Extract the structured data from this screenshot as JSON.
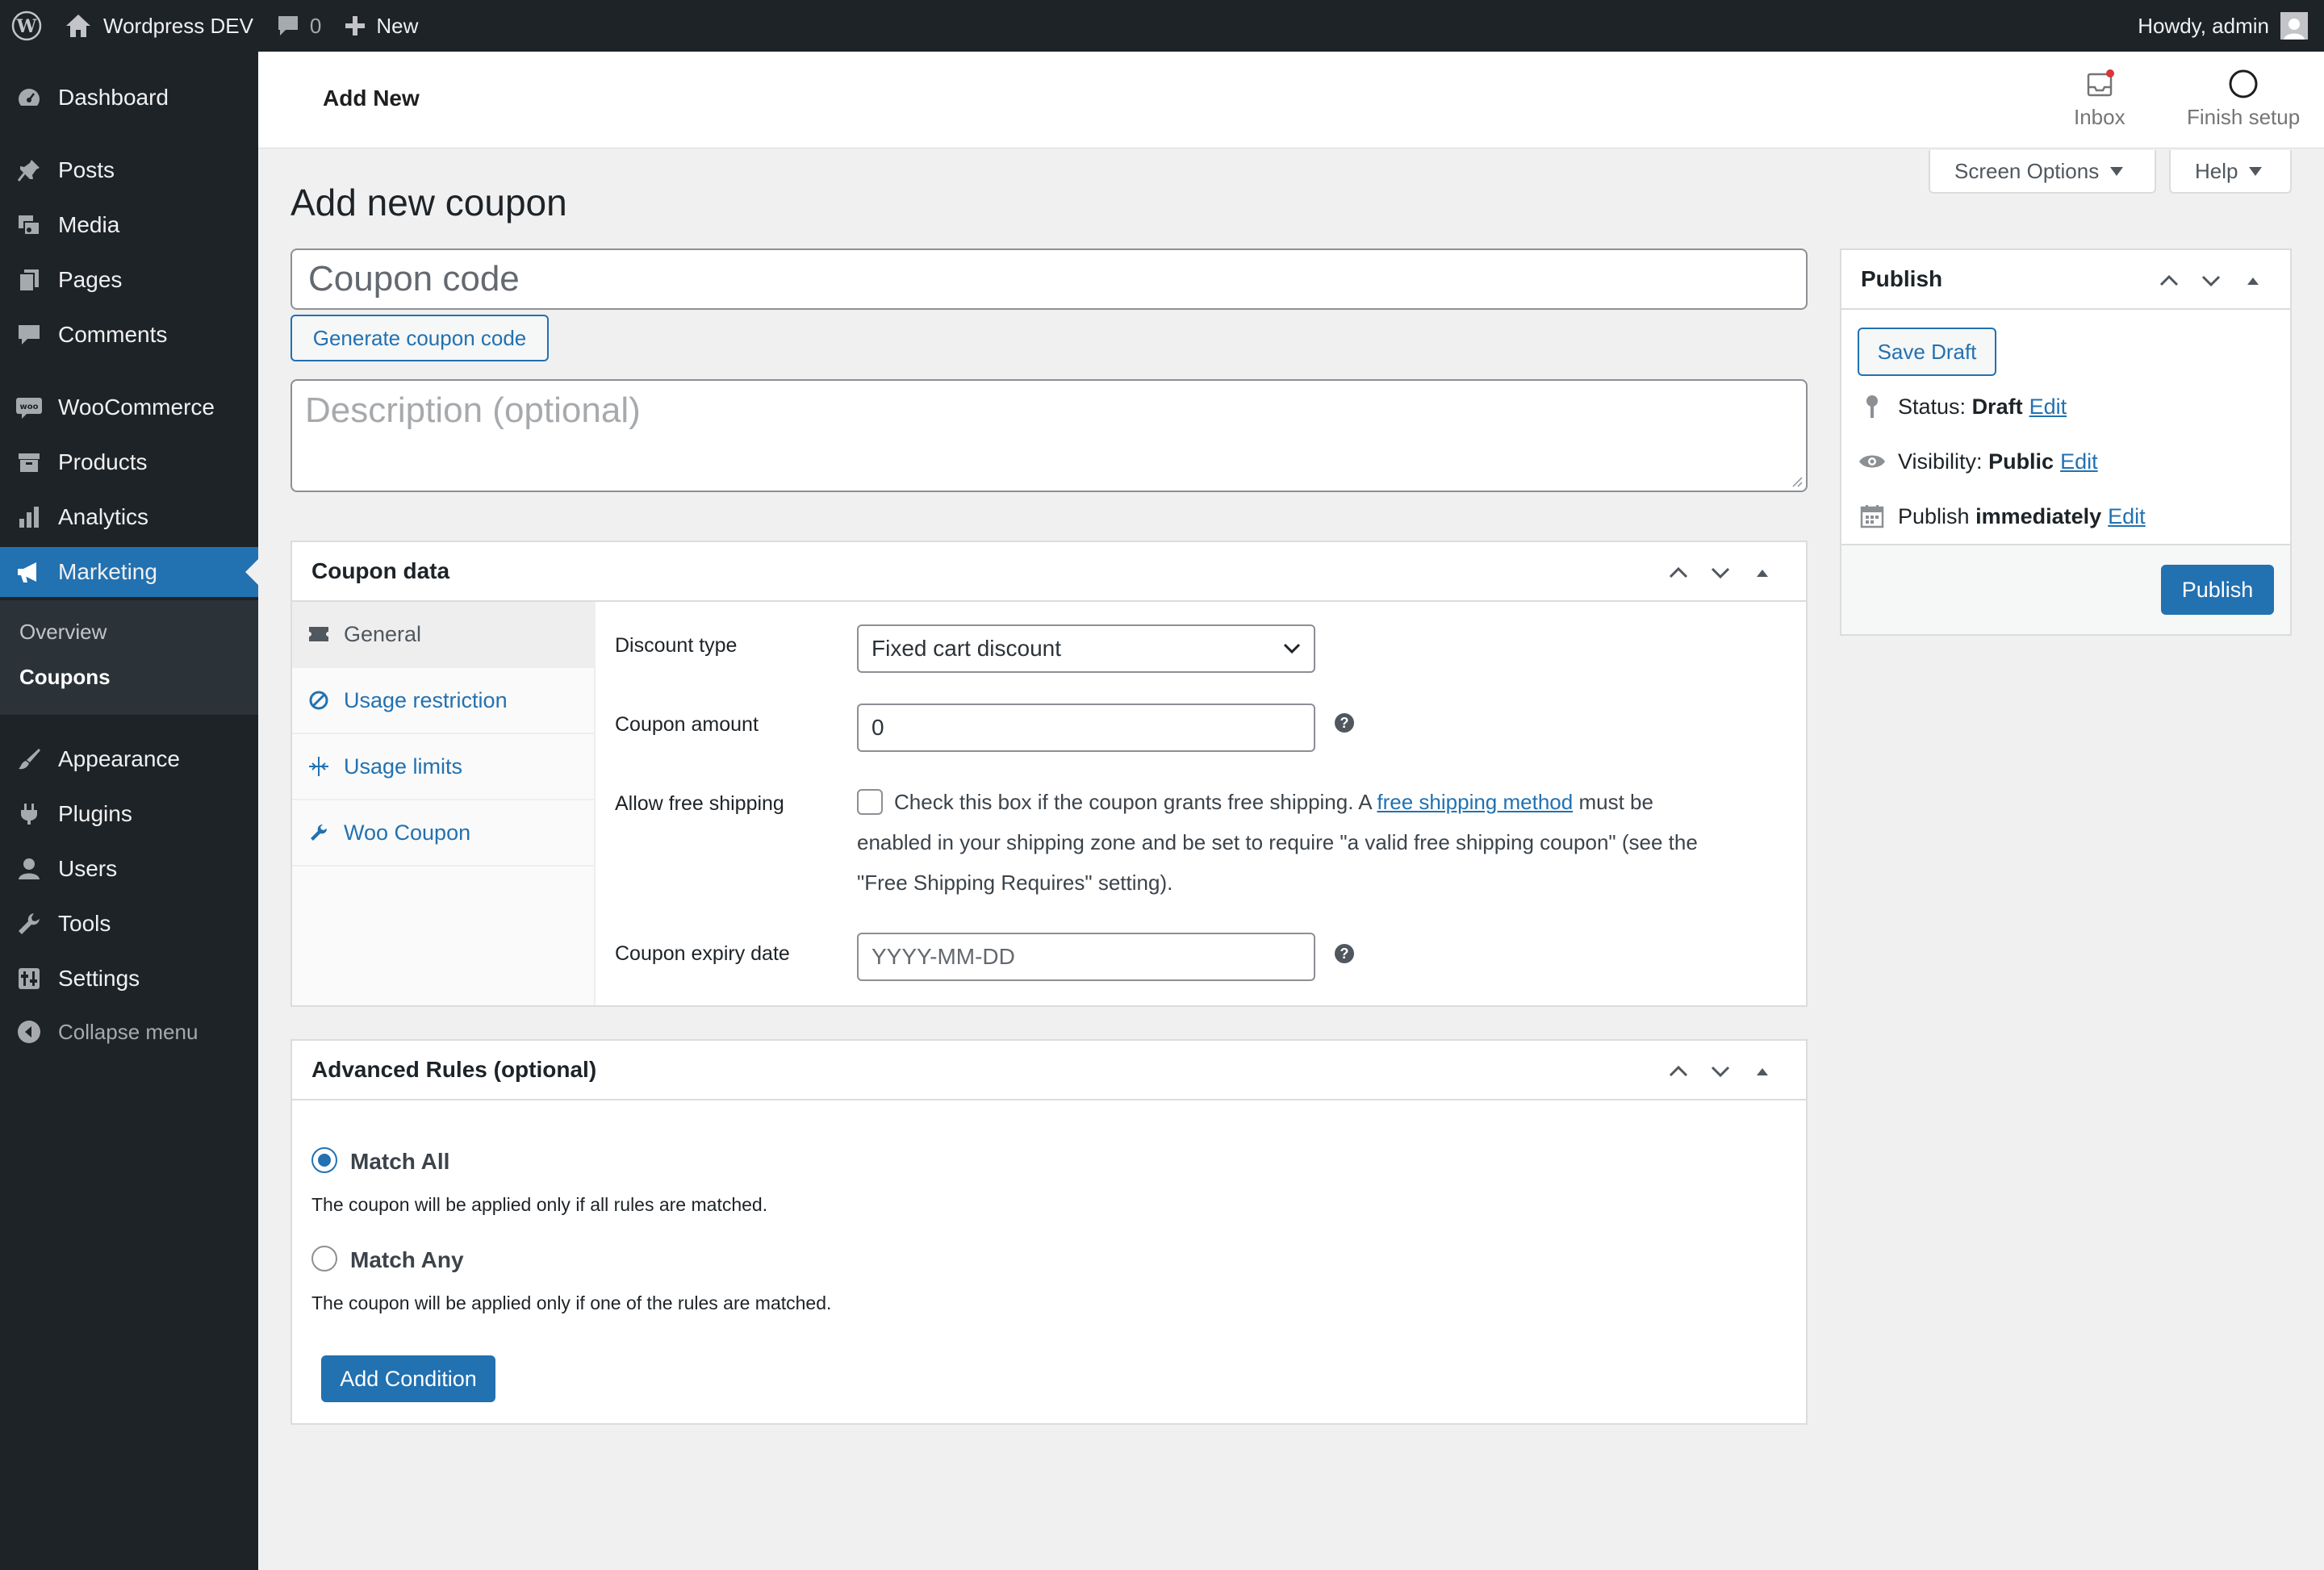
{
  "adminbar": {
    "site_name": "Wordpress DEV",
    "comments_count": "0",
    "new_label": "New",
    "howdy": "Howdy, admin"
  },
  "sidebar": {
    "items": [
      {
        "label": "Dashboard",
        "icon": "dashboard-icon"
      },
      {
        "label": "Posts",
        "icon": "pin-icon"
      },
      {
        "label": "Media",
        "icon": "media-icon"
      },
      {
        "label": "Pages",
        "icon": "pages-icon"
      },
      {
        "label": "Comments",
        "icon": "comment-icon"
      },
      {
        "label": "WooCommerce",
        "icon": "woo-icon"
      },
      {
        "label": "Products",
        "icon": "archive-icon"
      },
      {
        "label": "Analytics",
        "icon": "bar-chart-icon"
      },
      {
        "label": "Marketing",
        "icon": "megaphone-icon"
      },
      {
        "label": "Appearance",
        "icon": "brush-icon"
      },
      {
        "label": "Plugins",
        "icon": "plugin-icon"
      },
      {
        "label": "Users",
        "icon": "user-icon"
      },
      {
        "label": "Tools",
        "icon": "wrench-icon"
      },
      {
        "label": "Settings",
        "icon": "settings-icon"
      },
      {
        "label": "Collapse menu",
        "icon": "collapse-icon"
      }
    ],
    "submenu": [
      "Overview",
      "Coupons"
    ]
  },
  "header": {
    "title": "Add New",
    "inbox": "Inbox",
    "finish_setup": "Finish setup"
  },
  "tabs": {
    "screen_options": "Screen Options",
    "help": "Help"
  },
  "page": {
    "title": "Add new coupon",
    "coupon_code_placeholder": "Coupon code",
    "generate_button": "Generate coupon code",
    "description_placeholder": "Description (optional)"
  },
  "coupon_data": {
    "title": "Coupon data",
    "tabs": [
      "General",
      "Usage restriction",
      "Usage limits",
      "Woo Coupon"
    ],
    "fields": {
      "discount_type_label": "Discount type",
      "discount_type_value": "Fixed cart discount",
      "amount_label": "Coupon amount",
      "amount_value": "0",
      "free_shipping_label": "Allow free shipping",
      "free_shipping_text_1": "Check this box if the coupon grants free shipping. A",
      "free_shipping_link": "free shipping method",
      "free_shipping_text_2": "must be",
      "free_shipping_text_3": "enabled in your shipping zone and be set to require \"a valid free shipping coupon\" (see the",
      "free_shipping_text_4": "\"Free Shipping Requires\" setting).",
      "expiry_label": "Coupon expiry date",
      "expiry_placeholder": "YYYY-MM-DD"
    }
  },
  "advanced_rules": {
    "title": "Advanced Rules (optional)",
    "match_all": "Match All",
    "match_all_desc": "The coupon will be applied only if all rules are matched.",
    "match_any": "Match Any",
    "match_any_desc": "The coupon will be applied only if one of the rules are matched.",
    "add_condition": "Add Condition"
  },
  "publish": {
    "title": "Publish",
    "save_draft": "Save Draft",
    "status_label": "Status:",
    "status_value": "Draft",
    "visibility_label": "Visibility:",
    "visibility_value": "Public",
    "publish_label": "Publish",
    "publish_value": "immediately",
    "edit": "Edit",
    "publish_button": "Publish"
  },
  "colors": {
    "accent": "#2271b1",
    "sidebar_bg": "#1d2327",
    "body_bg": "#f0f0f1"
  }
}
